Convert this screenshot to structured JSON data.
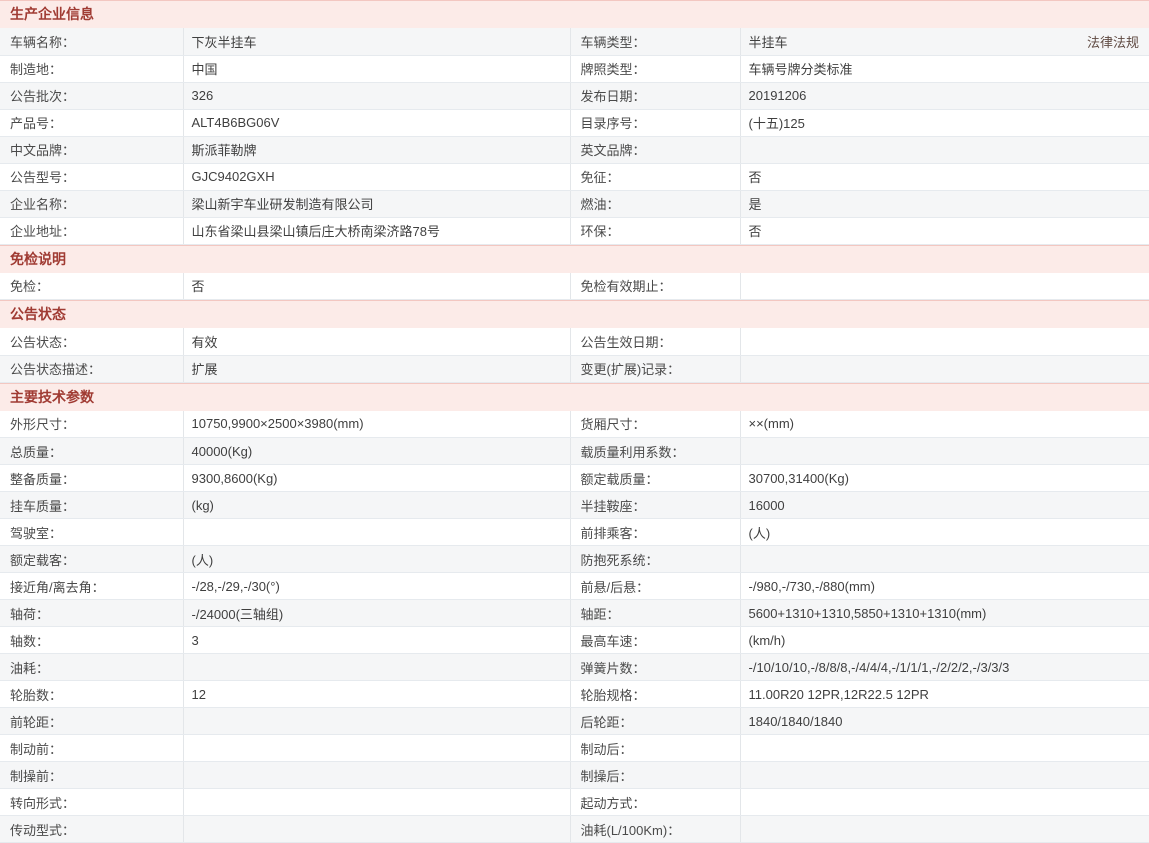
{
  "colors": {
    "section_header_bg": "#fcebe8",
    "section_header_text": "#a03b33",
    "section_header_border": "#f3c7c1",
    "row_alt_bg": "#f5f6f7",
    "row_bg": "#ffffff",
    "label_text": "#4a4a4a",
    "value_text": "#3f3f3f",
    "link_text": "#5f4a42"
  },
  "top_link": {
    "label": "法律法规"
  },
  "sections": [
    {
      "key": "production-company-info",
      "title": "生产企业信息",
      "stripe_first_row": true,
      "rows": [
        [
          "车辆名称：",
          "下灰半挂车",
          "车辆类型：",
          "半挂车"
        ],
        [
          "制造地：",
          "中国",
          "牌照类型：",
          "车辆号牌分类标准"
        ],
        [
          "公告批次：",
          "326",
          "发布日期：",
          "20191206"
        ],
        [
          "产品号：",
          "ALT4B6BG06V",
          "目录序号：",
          "(十五)125"
        ],
        [
          "中文品牌：",
          "斯派菲勒牌",
          "英文品牌：",
          ""
        ],
        [
          "公告型号：",
          "GJC9402GXH",
          "免征：",
          "否"
        ],
        [
          "企业名称：",
          "梁山新宇车业研发制造有限公司",
          "燃油：",
          "是"
        ],
        [
          "企业地址：",
          "山东省梁山县梁山镇后庄大桥南梁济路78号",
          "环保：",
          "否"
        ]
      ]
    },
    {
      "key": "exemption-note",
      "title": "免检说明",
      "stripe_first_row": false,
      "rows": [
        [
          "免检：",
          "否",
          "免检有效期止：",
          ""
        ]
      ]
    },
    {
      "key": "announcement-status",
      "title": "公告状态",
      "stripe_first_row": false,
      "rows": [
        [
          "公告状态：",
          "有效",
          "公告生效日期：",
          ""
        ],
        [
          "公告状态描述：",
          "扩展",
          "变更(扩展)记录：",
          ""
        ]
      ]
    },
    {
      "key": "main-technical-params",
      "title": "主要技术参数",
      "stripe_first_row": false,
      "rows": [
        [
          "外形尺寸：",
          "10750,9900×2500×3980(mm)",
          "货厢尺寸：",
          "××(mm)"
        ],
        [
          "总质量：",
          "40000(Kg)",
          "载质量利用系数：",
          ""
        ],
        [
          "整备质量：",
          "9300,8600(Kg)",
          "额定载质量：",
          "30700,31400(Kg)"
        ],
        [
          "挂车质量：",
          "(kg)",
          "半挂鞍座：",
          "16000"
        ],
        [
          "驾驶室：",
          "",
          "前排乘客：",
          "(人)"
        ],
        [
          "额定载客：",
          "(人)",
          "防抱死系统：",
          ""
        ],
        [
          "接近角/离去角：",
          "-/28,-/29,-/30(°)",
          "前悬/后悬：",
          "-/980,-/730,-/880(mm)"
        ],
        [
          "轴荷：",
          "-/24000(三轴组)",
          "轴距：",
          "5600+1310+1310,5850+1310+1310(mm)"
        ],
        [
          "轴数：",
          "3",
          "最高车速：",
          "(km/h)"
        ],
        [
          "油耗：",
          "",
          "弹簧片数：",
          "-/10/10/10,-/8/8/8,-/4/4/4,-/1/1/1,-/2/2/2,-/3/3/3"
        ],
        [
          "轮胎数：",
          "12",
          "轮胎规格：",
          "11.00R20 12PR,12R22.5 12PR"
        ],
        [
          "前轮距：",
          "",
          "后轮距：",
          "1840/1840/1840"
        ],
        [
          "制动前：",
          "",
          "制动后：",
          ""
        ],
        [
          "制操前：",
          "",
          "制操后：",
          ""
        ],
        [
          "转向形式：",
          "",
          "起动方式：",
          ""
        ],
        [
          "传动型式：",
          "",
          "油耗(L/100Km)：",
          ""
        ]
      ]
    }
  ]
}
